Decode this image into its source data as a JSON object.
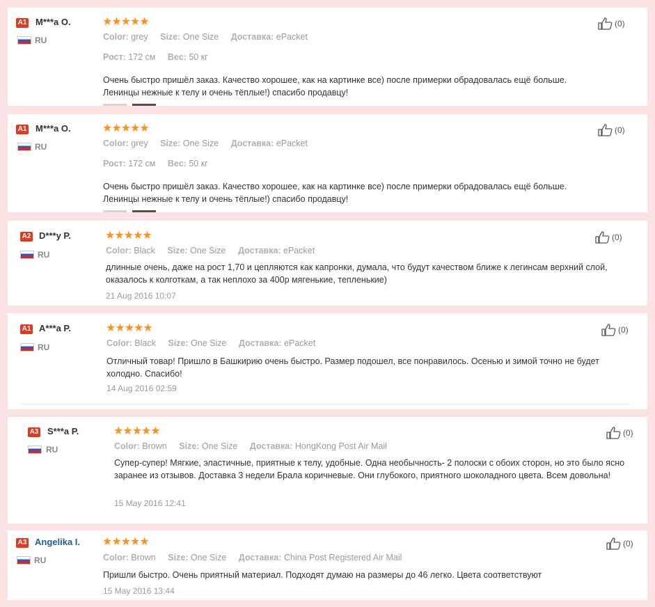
{
  "colors": {
    "accent_star": "#f7931e",
    "level_badge": "#e03b21",
    "page_bg": "#fbe3e3",
    "link": "#1f5b9d"
  },
  "icons": {
    "like": "thumbs-up-icon",
    "flag": "russia-flag-icon",
    "star": "star-icon"
  },
  "reviews": [
    {
      "level": "A1",
      "name": "M***a O.",
      "country": "RU",
      "stars": "★★★★★",
      "color_label": "Color:",
      "color": "grey",
      "size_label": "Size:",
      "size": "One Size",
      "ship_label": "Доставка:",
      "ship": "ePacket",
      "height_label": "Рост:",
      "height": "172 см",
      "weight_label": "Вес:",
      "weight": "50 кг",
      "text": "Очень быстро пришёл заказ. Качество хорошее, как на картинке все) после примерки обрадовалась ещё больше. Ленинцы нежные к телу и очень тёплые!) спасибо продавцу!",
      "likes": "(0)"
    },
    {
      "level": "A1",
      "name": "M***a O.",
      "country": "RU",
      "stars": "★★★★★",
      "color_label": "Color:",
      "color": "grey",
      "size_label": "Size:",
      "size": "One Size",
      "ship_label": "Доставка:",
      "ship": "ePacket",
      "height_label": "Рост:",
      "height": "172 см",
      "weight_label": "Вес:",
      "weight": "50 кг",
      "text": "Очень быстро пришёл заказ. Качество хорошее, как на картинке все) после примерки обрадовалась ещё больше. Ленинцы нежные к телу и очень тёплые!) спасибо продавцу!",
      "likes": "(0)"
    },
    {
      "level": "A2",
      "name": "D***y P.",
      "country": "RU",
      "stars": "★★★★★",
      "color_label": "Color:",
      "color": "Black",
      "size_label": "Size:",
      "size": "One Size",
      "ship_label": "Доставка:",
      "ship": "ePacket",
      "text": "длинные очень, даже на рост 1,70 и цепляются как капронки, думала, что будут качеством ближе к легинсам верхний слой, оказалось к колготкам, а так неплохо за 400р мягенькие, тепленькие)",
      "date": "21 Aug 2016 10:07",
      "likes": "(0)"
    },
    {
      "level": "A1",
      "name": "A***a P.",
      "country": "RU",
      "stars": "★★★★★",
      "color_label": "Color:",
      "color": "Black",
      "size_label": "Size:",
      "size": "One Size",
      "ship_label": "Доставка:",
      "ship": "ePacket",
      "text": "Отличный товар! Пришло в Башкирию очень быстро. Размер подошел, все понравилось. Осенью и зимой точно не будет холодно. Спасибо!",
      "date": "14 Aug 2016 02:59",
      "likes": "(0)"
    },
    {
      "level": "A3",
      "name": "S***a P.",
      "country": "RU",
      "stars": "★★★★★",
      "color_label": "Color:",
      "color": "Brown",
      "size_label": "Size:",
      "size": "One Size",
      "ship_label": "Доставка:",
      "ship": "HongKong Post Air Mail",
      "text": "Супер-супер! Мягкие, эластичные, приятные к телу, удобные. Одна необычность- 2 полоски с обоих сторон, но это было ясно заранее из отзывов. Доставка 3 недели Брала коричневые. Они глубокого, приятного шоколадного цвета. Всем довольна!",
      "date": "15 May 2016 12:41",
      "likes": "(0)"
    },
    {
      "level": "A3",
      "name": "Angelika I.",
      "country": "RU",
      "stars": "★★★★★",
      "color_label": "Color:",
      "color": "Brown",
      "size_label": "Size:",
      "size": "One Size",
      "ship_label": "Доставка:",
      "ship": "China Post Registered Air Mail",
      "text": "Пришли быстро. Очень приятный материал. Подходят думаю на размеры до 46 легко. Цвета соответствуют",
      "date": "15 May 2016 13:44",
      "likes": "(0)"
    }
  ]
}
